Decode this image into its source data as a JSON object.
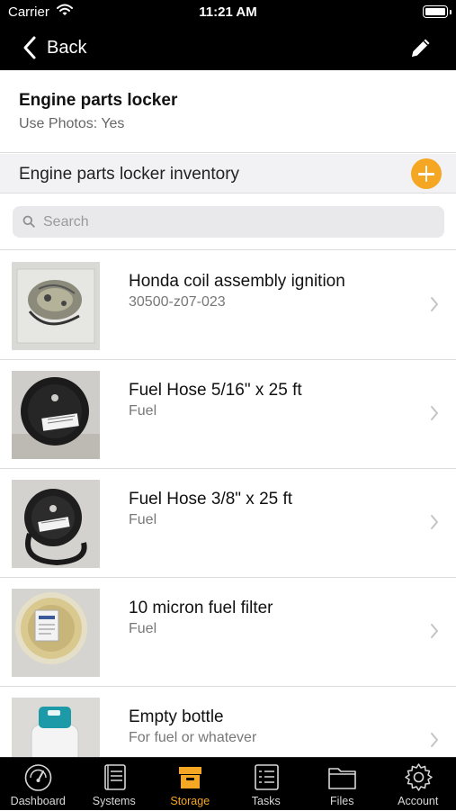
{
  "status": {
    "carrier": "Carrier",
    "time": "11:21 AM"
  },
  "nav": {
    "back_label": "Back"
  },
  "locker": {
    "title": "Engine parts locker",
    "subtitle": "Use Photos: Yes"
  },
  "inventory": {
    "header": "Engine parts locker inventory"
  },
  "search": {
    "placeholder": "Search"
  },
  "items": [
    {
      "title": "Honda coil assembly ignition",
      "subtitle": "30500-z07-023",
      "thumb": "coil"
    },
    {
      "title": "Fuel Hose 5/16\" x 25 ft",
      "subtitle": "Fuel",
      "thumb": "hose"
    },
    {
      "title": "Fuel Hose 3/8\" x 25 ft",
      "subtitle": "Fuel",
      "thumb": "hose"
    },
    {
      "title": "10 micron fuel filter",
      "subtitle": "Fuel",
      "thumb": "filter"
    },
    {
      "title": "Empty bottle",
      "subtitle": "For fuel or whatever",
      "thumb": "bottle"
    }
  ],
  "tabs": [
    {
      "label": "Dashboard",
      "icon": "speedometer-icon",
      "active": false
    },
    {
      "label": "Systems",
      "icon": "book-icon",
      "active": false
    },
    {
      "label": "Storage",
      "icon": "storage-box-icon",
      "active": true
    },
    {
      "label": "Tasks",
      "icon": "checklist-icon",
      "active": false
    },
    {
      "label": "Files",
      "icon": "folder-icon",
      "active": false
    },
    {
      "label": "Account",
      "icon": "gear-icon",
      "active": false
    }
  ],
  "colors": {
    "accent": "#f5a623",
    "bar": "#000000"
  }
}
